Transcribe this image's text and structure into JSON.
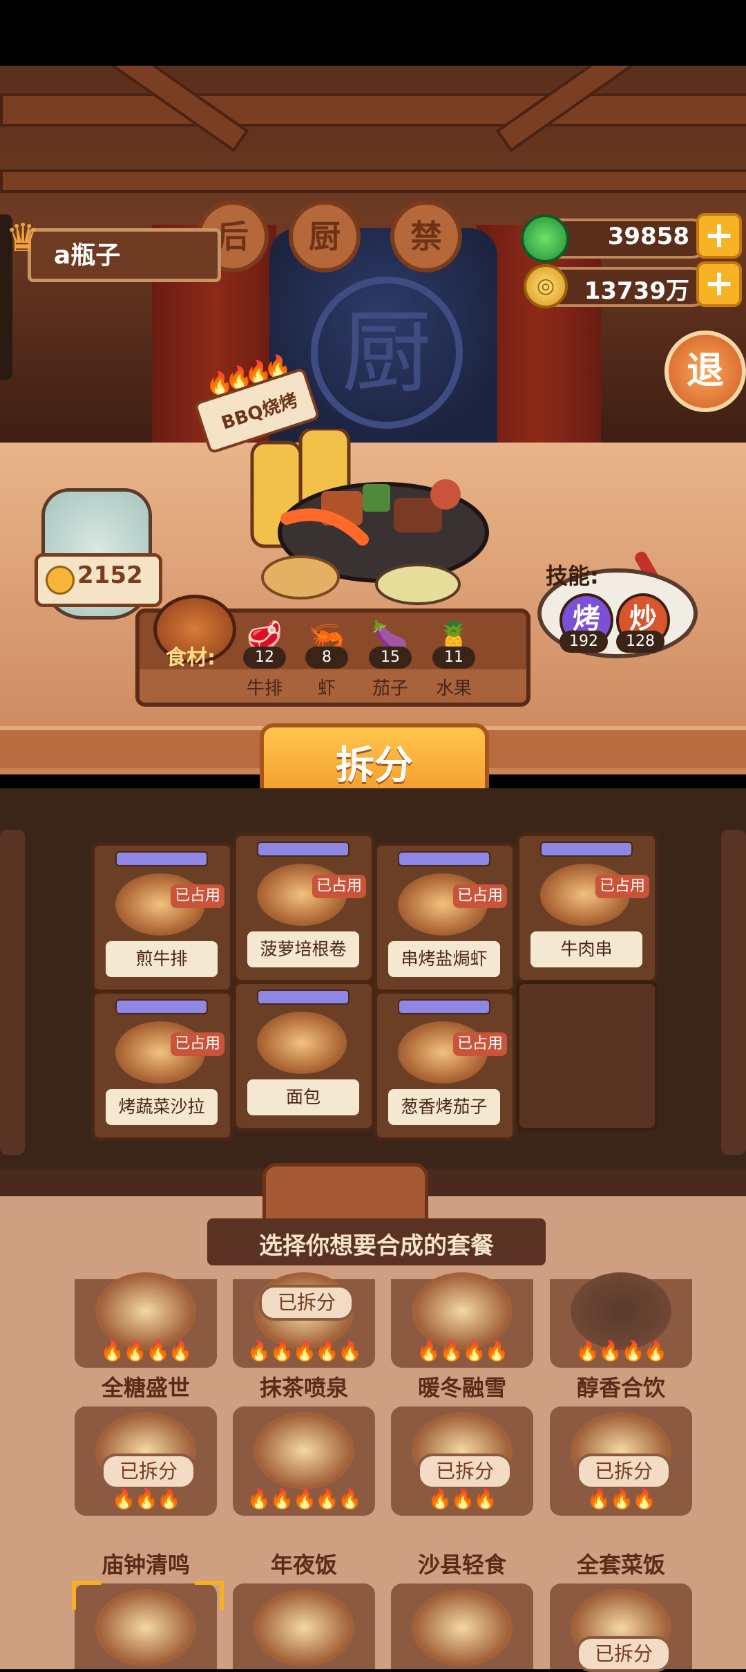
{
  "header": {
    "user_name": "a瓶子",
    "jade_value": "39858",
    "coin_value": "13739万",
    "plus_label": "+",
    "exit_label": "退",
    "plaques": [
      "后",
      "厨",
      "禁"
    ],
    "banner_logo": "厨"
  },
  "dish": {
    "name": "BBQ烧烤",
    "heat": "4"
  },
  "jar": {
    "coin_label": "2152"
  },
  "ingredients": {
    "title": "食材:",
    "items": [
      {
        "name": "牛排",
        "count": "12",
        "icon": "steak-icon"
      },
      {
        "name": "虾",
        "count": "8",
        "icon": "shrimp-icon"
      },
      {
        "name": "茄子",
        "count": "15",
        "icon": "eggplant-icon"
      },
      {
        "name": "水果",
        "count": "11",
        "icon": "fruit-icon"
      }
    ]
  },
  "skills": {
    "title": "技能:",
    "items": [
      {
        "label": "烤",
        "value": "192",
        "color": "#7b4fd6"
      },
      {
        "label": "炒",
        "value": "128",
        "color": "#d8562c"
      }
    ]
  },
  "split_button": "拆分",
  "dishes": [
    {
      "name": "煎牛排",
      "badge": "已占用"
    },
    {
      "name": "菠萝培根卷",
      "badge": "已占用"
    },
    {
      "name": "串烤盐焗虾",
      "badge": "已占用"
    },
    {
      "name": "牛肉串",
      "badge": "已占用"
    },
    {
      "name": "烤蔬菜沙拉",
      "badge": "已占用"
    },
    {
      "name": "面包",
      "badge": ""
    },
    {
      "name": "葱香烤茄子",
      "badge": "已占用"
    }
  ],
  "sets_panel": {
    "title": "选择你想要合成的套餐",
    "sets": [
      {
        "name": "全糖盛世",
        "badge": "",
        "flames": "🔥🔥🔥🔥"
      },
      {
        "name": "抹茶喷泉",
        "badge": "已拆分",
        "flames": "🔥🔥🔥🔥🔥"
      },
      {
        "name": "暖冬融雪",
        "badge": "",
        "flames": "🔥🔥🔥🔥"
      },
      {
        "name": "醇香合饮",
        "badge": "",
        "flames": "🔥🔥🔥🔥"
      },
      {
        "name": "庙钟清鸣",
        "badge": "已拆分",
        "flames": "🔥🔥🔥"
      },
      {
        "name": "年夜饭",
        "badge": "",
        "flames": "🔥🔥🔥🔥🔥"
      },
      {
        "name": "沙县轻食",
        "badge": "已拆分",
        "flames": "🔥🔥🔥"
      },
      {
        "name": "全套菜饭",
        "badge": "已拆分",
        "flames": "🔥🔥🔥"
      },
      {
        "name": "",
        "badge": "",
        "flames": ""
      },
      {
        "name": "",
        "badge": "",
        "flames": ""
      },
      {
        "name": "",
        "badge": "",
        "flames": ""
      },
      {
        "name": "",
        "badge": "已拆分",
        "flames": ""
      }
    ]
  }
}
